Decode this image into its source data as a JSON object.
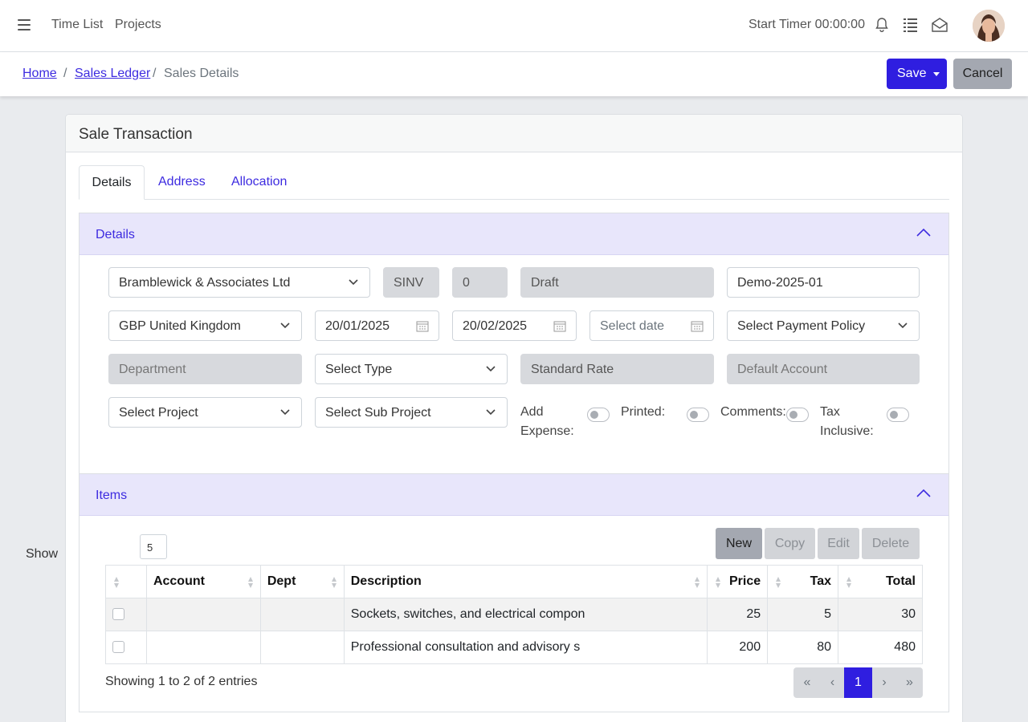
{
  "topbar": {
    "nav": [
      "Time List",
      "Projects"
    ],
    "timer_label": "Start Timer 00:00:00"
  },
  "breadcrumb": {
    "home": "Home",
    "ledger": "Sales Ledger",
    "current": "Sales Details",
    "separator": "/"
  },
  "actions": {
    "save": "Save",
    "cancel": "Cancel"
  },
  "card": {
    "title": "Sale Transaction"
  },
  "tabs": [
    "Details",
    "Address",
    "Allocation"
  ],
  "details": {
    "title": "Details",
    "customer": "Bramblewick & Associates Ltd",
    "prefix": "SINV",
    "number": "0",
    "status": "Draft",
    "reference": "Demo-2025-01",
    "currency": "GBP United Kingdom",
    "date": "20/01/2025",
    "due_date": "20/02/2025",
    "extra_date_placeholder": "Select date",
    "payment_policy": "Select Payment Policy",
    "department": "Department",
    "type": "Select Type",
    "tax_rate": "Standard Rate",
    "account": "Default Account",
    "project": "Select Project",
    "sub_project": "Select Sub Project",
    "add_expense_1": "Add",
    "add_expense_2": "Expense:",
    "printed": "Printed:",
    "comments": "Comments:",
    "tax_inclusive_1": "Tax",
    "tax_inclusive_2": "Inclusive:"
  },
  "items": {
    "title": "Items",
    "show_label": "Show",
    "page_size": "5",
    "buttons": {
      "new": "New",
      "copy": "Copy",
      "edit": "Edit",
      "delete": "Delete"
    },
    "columns": [
      "",
      "Account",
      "Dept",
      "Description",
      "Price",
      "Tax",
      "Total"
    ],
    "rows": [
      {
        "account": "",
        "dept": "",
        "description": "Sockets, switches, and electrical compon",
        "price": "25",
        "tax": "5",
        "total": "30"
      },
      {
        "account": "",
        "dept": "",
        "description": "Professional consultation and advisory s",
        "price": "200",
        "tax": "80",
        "total": "480"
      }
    ],
    "entries_text": "Showing 1 to 2 of 2 entries",
    "pager": {
      "first": "«",
      "prev": "‹",
      "page": "1",
      "next": "›",
      "last": "»"
    }
  },
  "colors": {
    "accent": "#2f1ee0",
    "section_header": "#e8e6fb",
    "disabled_field": "#d7d9dd"
  },
  "icons": [
    "menu-icon",
    "bell-icon",
    "list-icon",
    "mail-icon",
    "chevron-down-icon",
    "chevron-up-icon",
    "calendar-icon",
    "sort-icon"
  ]
}
